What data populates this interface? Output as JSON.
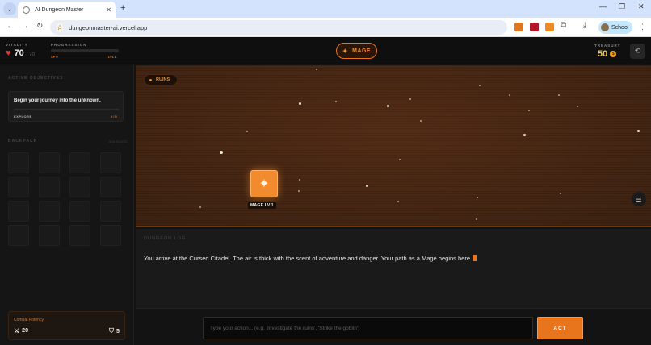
{
  "browser": {
    "tab_title": "AI Dungeon Master",
    "url": "dungeonmaster-ai.vercel.app",
    "profile_name": "School"
  },
  "header": {
    "vitality_label": "VITALITY",
    "vitality_value": "70",
    "vitality_max": "/ 70",
    "progression_label": "PROGRESSION",
    "progression_fraction": 0.0,
    "xp_text": "XP 0",
    "level_text": "LVL 1",
    "class_name": "MAGE",
    "treasury_label": "TREASURY",
    "treasury_value": "50",
    "coin_symbol": "$"
  },
  "sidebar": {
    "objectives_title": "ACTIVE OBJECTIVES",
    "objective_text": "Begin your journey into the unknown.",
    "objective_type": "EXPLORE",
    "objective_count": "0 / 3",
    "backpack_title": "BACKPACK",
    "backpack_capacity": "0/16 SLOTS",
    "slot_count": 16,
    "potency_label": "Combat Potency",
    "attack_value": "20",
    "defense_value": "5"
  },
  "scene": {
    "location": "RUINS",
    "player_label": "MAGE LV.1"
  },
  "log": {
    "title": "DUNGEON LOG",
    "entry": "You arrive at the Cursed Citadel. The air is thick with the scent of adventure and danger. Your path as a Mage begins here."
  },
  "action": {
    "placeholder": "Type your action... (e.g. 'Investigate the ruins', 'Strike the goblin')",
    "button_label": "ACT"
  },
  "colors": {
    "accent": "#e8741b",
    "gold": "#f5c542",
    "heart": "#e53935"
  }
}
